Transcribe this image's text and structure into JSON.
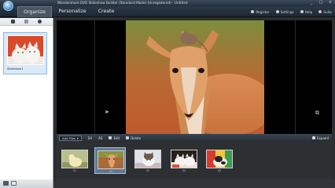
{
  "window": {
    "title": "Wondershare DVD Slideshow Builder (Standard Mode) (Unregistered) - Untitled",
    "controls": [
      "_",
      "□",
      "×"
    ]
  },
  "nav": {
    "tabs": [
      {
        "label": "Organize",
        "active": true
      },
      {
        "label": "Personalize",
        "active": false
      },
      {
        "label": "Create",
        "active": false
      }
    ],
    "links": [
      {
        "label": "Register",
        "icon": "gear-icon"
      },
      {
        "label": "Settings",
        "icon": "settings-icon"
      },
      {
        "label": "Help",
        "icon": "help-icon"
      },
      {
        "label": "Suite",
        "icon": "heart-icon"
      }
    ]
  },
  "left_panel": {
    "tools": [
      "copy-icon",
      "trash-icon",
      "info-icon"
    ],
    "album": {
      "label": "Slideshow1"
    }
  },
  "toolbar": {
    "add_files": "Add Files",
    "buttons": [
      {
        "label": "",
        "icon": "text-size-icon",
        "text": "SA"
      },
      {
        "label": "",
        "icon": "text-size-icon",
        "text": "AS"
      },
      {
        "label": "Edit",
        "icon": "edit-icon"
      },
      {
        "label": "Delete",
        "icon": "delete-icon"
      }
    ],
    "expand": "Expand"
  },
  "timeline": {
    "items": [
      {
        "number": "01",
        "subject": "duckling",
        "selected": false
      },
      {
        "number": "02",
        "subject": "antelope",
        "selected": true
      },
      {
        "number": "03",
        "subject": "kitten",
        "selected": false
      },
      {
        "number": "04",
        "subject": "kittens",
        "selected": false
      },
      {
        "number": "05",
        "subject": "puppy",
        "selected": false
      }
    ]
  },
  "colors": {
    "accent": "#5f7893",
    "panel_bg": "#ffffff",
    "dark_bg": "#2b2d30"
  }
}
